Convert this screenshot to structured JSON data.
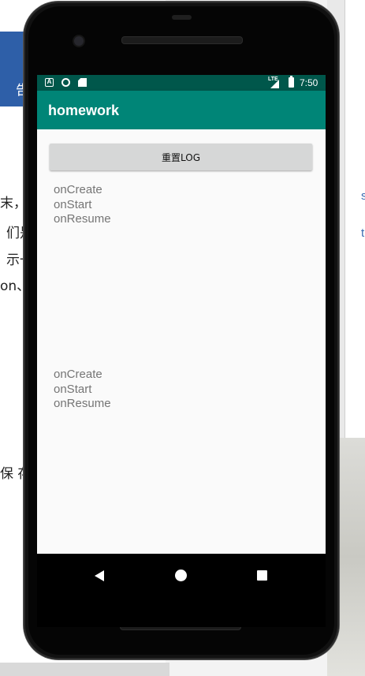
{
  "background": {
    "left_lines": [
      "告",
      "末，",
      "们是",
      "示一",
      "on、",
      "保 存"
    ],
    "right_lines": [
      "s",
      "t"
    ]
  },
  "status_bar": {
    "a_icon": "A",
    "network": "LTE",
    "time": "7:50"
  },
  "app_bar": {
    "title": "homework"
  },
  "main": {
    "reset_button_label": "重置LOG",
    "log_top": [
      "onCreate",
      "onStart",
      "onResume"
    ],
    "log_bottom": [
      "onCreate",
      "onStart",
      "onResume"
    ]
  },
  "colors": {
    "status_bar": "#00574b",
    "app_bar": "#008577",
    "content_bg": "#fafafa",
    "button_bg": "#d6d7d7",
    "log_text": "#757575"
  }
}
